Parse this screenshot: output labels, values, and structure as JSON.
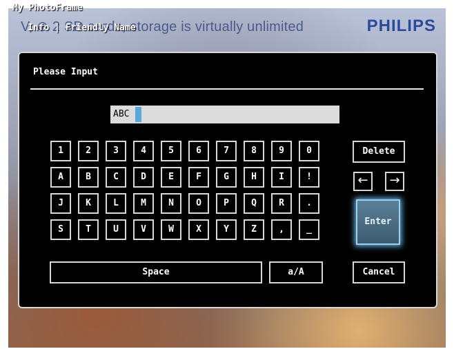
{
  "header": {
    "app_title": "My PhotoFrame",
    "breadcrumb": "Info | Friendly Name",
    "background_caption": "V, ⊕ 2 SD cards, storage is virtually unlimited",
    "brand": "PHILIPS"
  },
  "dialog": {
    "title": "Please Input",
    "input_value": "ABC",
    "keys_row1": [
      "1",
      "2",
      "3",
      "4",
      "5",
      "6",
      "7",
      "8",
      "9",
      "0"
    ],
    "keys_row2": [
      "A",
      "B",
      "C",
      "D",
      "E",
      "F",
      "G",
      "H",
      "I",
      "!"
    ],
    "keys_row3": [
      "J",
      "K",
      "L",
      "M",
      "N",
      "O",
      "P",
      "Q",
      "R",
      "."
    ],
    "keys_row4": [
      "S",
      "T",
      "U",
      "V",
      "W",
      "X",
      "Y",
      "Z",
      ",",
      "_"
    ],
    "space_label": "Space",
    "case_label": "a/A",
    "delete_label": "Delete",
    "left_arrow": "←",
    "right_arrow": "→",
    "enter_label": "Enter",
    "cancel_label": "Cancel"
  },
  "colors": {
    "accent": "#5aa8d8",
    "enter_glow": "#6ab6e6",
    "brand": "#2a4a9a"
  }
}
